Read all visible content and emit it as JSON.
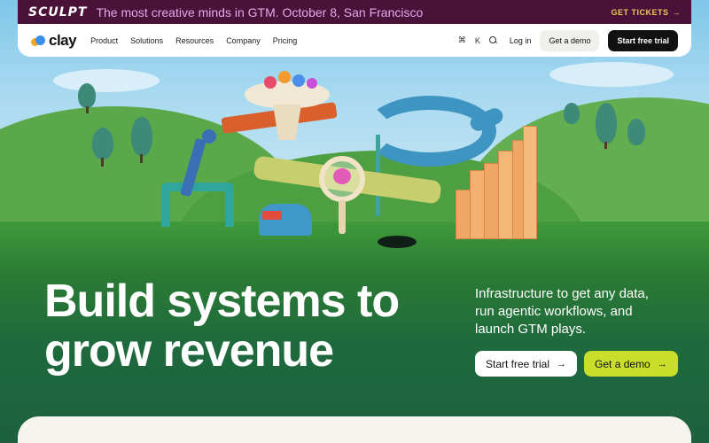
{
  "banner": {
    "logo": "SCULPT",
    "promo": "The most creative minds in GTM. October 8, San Francisco",
    "tickets": "GET TICKETS",
    "tickets_arrow": "→"
  },
  "nav": {
    "brand": "clay",
    "menu": [
      "Product",
      "Solutions",
      "Resources",
      "Company",
      "Pricing"
    ],
    "shortcut_cmd": "⌘",
    "shortcut_key": "K",
    "login": "Log in",
    "demo": "Get a demo",
    "trial": "Start free trial"
  },
  "hero": {
    "headline_line1": "Build systems to",
    "headline_line2": "grow revenue",
    "subtext": "Infrastructure to get any data, run agentic workflows, and launch GTM plays.",
    "cta_trial": "Start free trial",
    "cta_demo": "Get a demo",
    "arrow": "→"
  },
  "colors": {
    "banner_bg": "#4a1139",
    "accent_lime": "#c8de2b",
    "hero_green": "#1f6a3d"
  }
}
